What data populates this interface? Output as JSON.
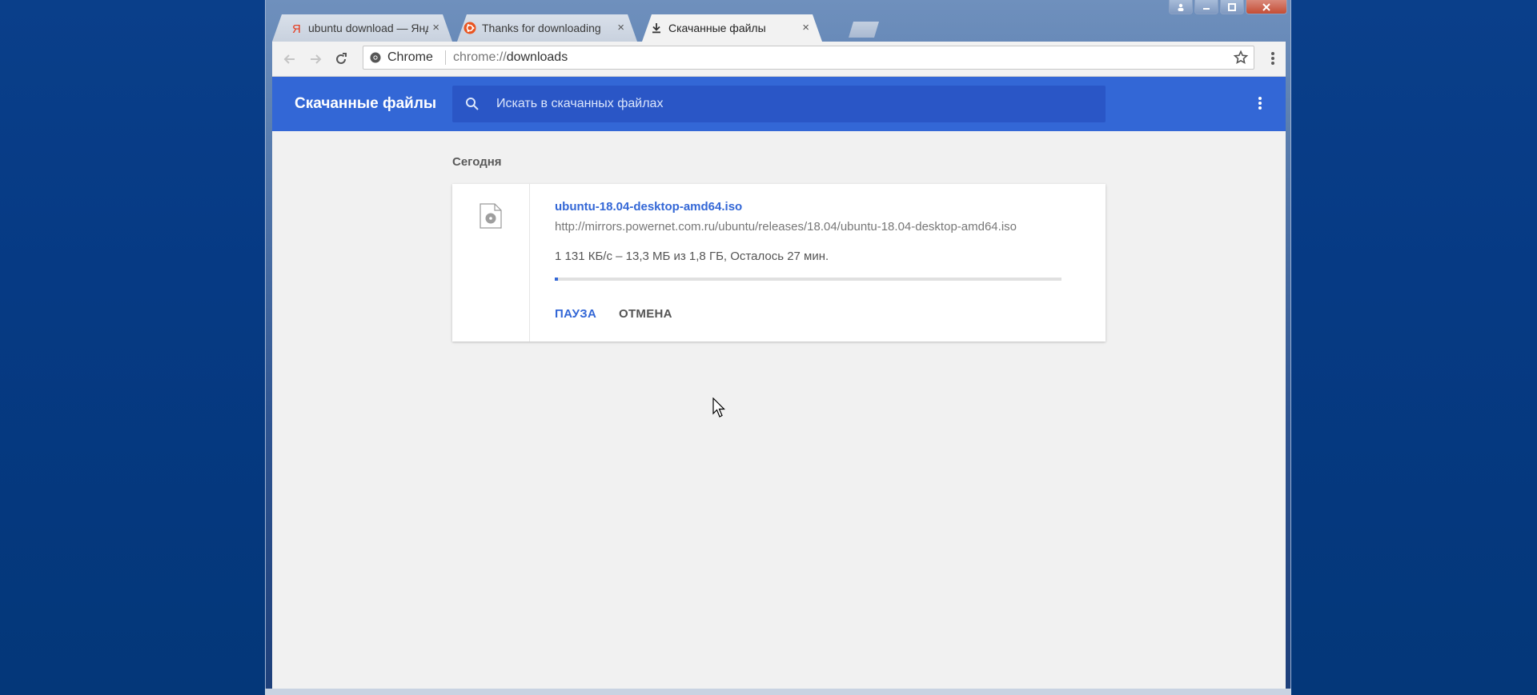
{
  "tabs": [
    {
      "label": "ubuntu download — Янд",
      "icon": "yandex-icon",
      "close": "×"
    },
    {
      "label": "Thanks for downloading",
      "icon": "ubuntu-icon",
      "close": "×"
    },
    {
      "label": "Скачанные файлы",
      "icon": "download-icon",
      "close": "×",
      "active": true
    }
  ],
  "omnibox": {
    "chip": "Chrome",
    "url_scheme": "chrome://",
    "url_path": "downloads"
  },
  "header": {
    "title": "Скачанные файлы",
    "search_placeholder": "Искать в скачанных файлах"
  },
  "downloads": {
    "section_date": "Сегодня",
    "item": {
      "filename": "ubuntu-18.04-desktop-amd64.iso",
      "url": "http://mirrors.powernet.com.ru/ubuntu/releases/18.04/ubuntu-18.04-desktop-amd64.iso",
      "status": "1 131 КБ/с – 13,3 МБ из 1,8 ГБ, Осталось 27 мин.",
      "progress_percent": 0.7,
      "pause_label": "ПАУЗА",
      "cancel_label": "ОТМЕНА"
    }
  },
  "colors": {
    "accent": "#3367d6",
    "desktop": "#043c88"
  }
}
